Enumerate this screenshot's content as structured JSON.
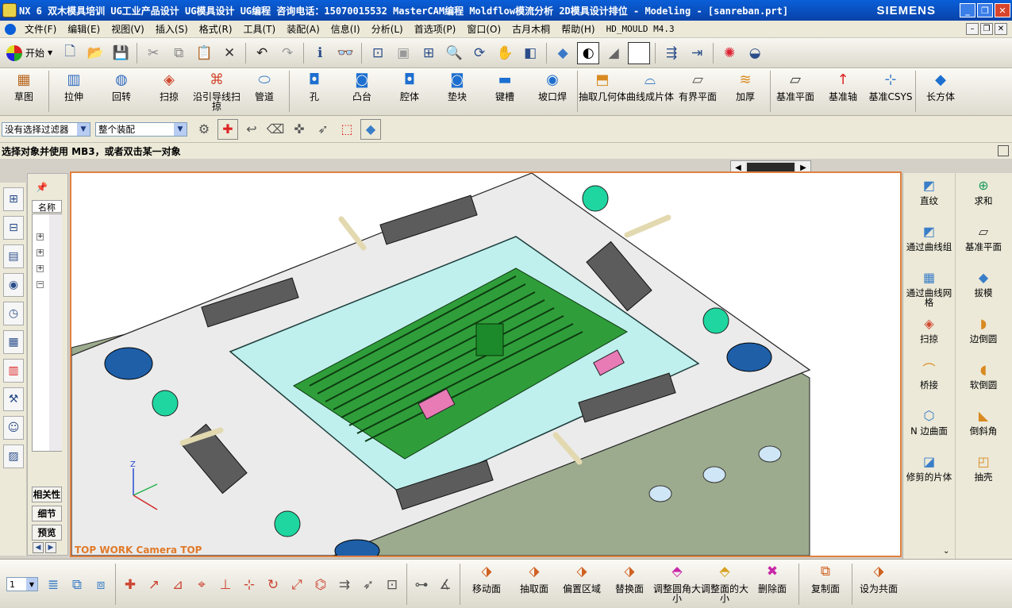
{
  "window": {
    "title": "NX 6 双木模具培训 UG工业产品设计 UG模具设计 UG编程 咨询电话：15070015532 MasterCAM编程 Moldflow模流分析 2D模具设计排位 - Modeling - [sanreban.prt]",
    "brand": "SIEMENS",
    "controls": [
      "_",
      "❐",
      "✕"
    ]
  },
  "menu": {
    "items": [
      "文件(F)",
      "编辑(E)",
      "视图(V)",
      "插入(S)",
      "格式(R)",
      "工具(T)",
      "装配(A)",
      "信息(I)",
      "分析(L)",
      "首选项(P)",
      "窗口(O)",
      "古月木桐",
      "帮助(H)",
      "HD_MOULD M4.3"
    ],
    "mdi_controls": [
      "–",
      "❐",
      "✕"
    ]
  },
  "toolbar_standard": {
    "start_label": "开始",
    "icons": [
      "new-file",
      "open-folder",
      "save",
      "cut",
      "copy",
      "paste",
      "delete",
      "undo",
      "redo",
      "info",
      "binoculars",
      "fit-view",
      "zoom-area",
      "zoom-window",
      "zoom",
      "rotate",
      "pan",
      "perspective",
      "view-orient",
      "shaded",
      "render-style",
      "background",
      "wcs",
      "csys",
      "color",
      "edge-display"
    ]
  },
  "ribbon": {
    "buttons": [
      {
        "label": "草图",
        "icon": "sketch"
      },
      {
        "label": "拉伸",
        "icon": "extrude"
      },
      {
        "label": "回转",
        "icon": "revolve"
      },
      {
        "label": "扫掠",
        "icon": "sweep"
      },
      {
        "label": "沿引导线扫掠",
        "icon": "sweep-guide"
      },
      {
        "label": "管道",
        "icon": "tube"
      },
      {
        "label": "孔",
        "icon": "hole"
      },
      {
        "label": "凸台",
        "icon": "boss"
      },
      {
        "label": "腔体",
        "icon": "pocket"
      },
      {
        "label": "垫块",
        "icon": "pad"
      },
      {
        "label": "键槽",
        "icon": "slot"
      },
      {
        "label": "坡口焊",
        "icon": "groove"
      },
      {
        "label": "抽取几何体",
        "icon": "extract"
      },
      {
        "label": "曲线成片体",
        "icon": "curve-to-sheet"
      },
      {
        "label": "有界平面",
        "icon": "bounded-plane"
      },
      {
        "label": "加厚",
        "icon": "thicken"
      },
      {
        "label": "基准平面",
        "icon": "datum-plane"
      },
      {
        "label": "基准轴",
        "icon": "datum-axis"
      },
      {
        "label": "基准CSYS",
        "icon": "datum-csys"
      },
      {
        "label": "长方体",
        "icon": "block"
      }
    ]
  },
  "selection_bar": {
    "filter_value": "没有选择过滤器",
    "scope_value": "整个装配"
  },
  "cue_line": "选择对象并使用 MB3，或者双击某一对象",
  "navigator": {
    "column_header": "名称",
    "tabs": [
      "相关性",
      "细节",
      "预览"
    ]
  },
  "viewport": {
    "label": "TOP WORK Camera TOP",
    "triad": {
      "z": "Z",
      "y": "Y",
      "x": "X"
    },
    "colors": {
      "plate": "#e8e8e8",
      "side": "#9cab8e",
      "cavity": "#bff0ee",
      "part": "#2f9e3a",
      "insert": "#e87ab6",
      "accent": "#1fd6a0",
      "hole": "#2b6fb0"
    }
  },
  "right_panel": {
    "column1": [
      {
        "label": "直纹",
        "icon": "ruled"
      },
      {
        "label": "通过曲线组",
        "icon": "through-curves"
      },
      {
        "label": "通过曲线网格",
        "icon": "curve-mesh"
      },
      {
        "label": "扫掠",
        "icon": "sweep"
      },
      {
        "label": "桥接",
        "icon": "bridge"
      },
      {
        "label": "N 边曲面",
        "icon": "n-sided"
      },
      {
        "label": "修剪的片体",
        "icon": "trimmed-sheet"
      }
    ],
    "column2": [
      {
        "label": "求和",
        "icon": "unite"
      },
      {
        "label": "基准平面",
        "icon": "datum-plane"
      },
      {
        "label": "拔模",
        "icon": "draft"
      },
      {
        "label": "边倒圆",
        "icon": "edge-blend"
      },
      {
        "label": "软倒圆",
        "icon": "soft-blend"
      },
      {
        "label": "倒斜角",
        "icon": "chamfer"
      },
      {
        "label": "抽壳",
        "icon": "shell"
      }
    ]
  },
  "bottom_bar": {
    "layer_value": "1",
    "icons": [
      "layer-settings",
      "move-layer",
      "copy-layer",
      "point-constructor",
      "vector",
      "plane",
      "csys-dynamic",
      "absolute-csys",
      "wcs-origin",
      "rotate-wcs",
      "orient-wcs",
      "snap",
      "selection-intent",
      "cursor-select",
      "select-all",
      "measure-distance",
      "measure-angle"
    ],
    "sync_buttons": [
      {
        "label": "移动面",
        "icon": "move-face"
      },
      {
        "label": "抽取面",
        "icon": "pull-face"
      },
      {
        "label": "偏置区域",
        "icon": "offset-region"
      },
      {
        "label": "替换面",
        "icon": "replace-face"
      },
      {
        "label": "调整圆角大小",
        "icon": "resize-blend"
      },
      {
        "label": "调整面的大小",
        "icon": "resize-face"
      },
      {
        "label": "删除面",
        "icon": "delete-face"
      },
      {
        "label": "复制面",
        "icon": "copy-face"
      },
      {
        "label": "设为共面",
        "icon": "make-coplanar"
      }
    ]
  }
}
